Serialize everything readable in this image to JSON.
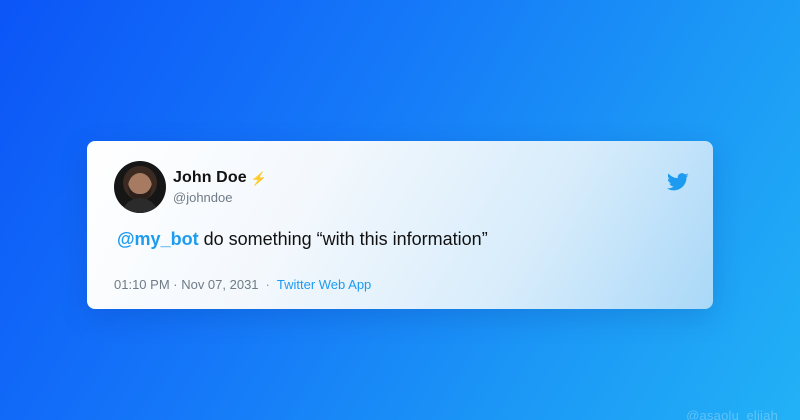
{
  "tweet": {
    "author_name": "John Doe",
    "author_handle": "@johndoe",
    "verified_icon": "lightning-icon",
    "mention": "@my_bot",
    "body": " do something “with this information”",
    "time": "01:10 PM · Nov 07, 2031",
    "separator": "·",
    "client": "Twitter Web App"
  },
  "branding": {
    "logo_icon": "twitter-bird-icon",
    "watermark": "@asaolu_elijah"
  },
  "colors": {
    "accent": "#1d9bf0",
    "bolt": "#f5a623"
  }
}
